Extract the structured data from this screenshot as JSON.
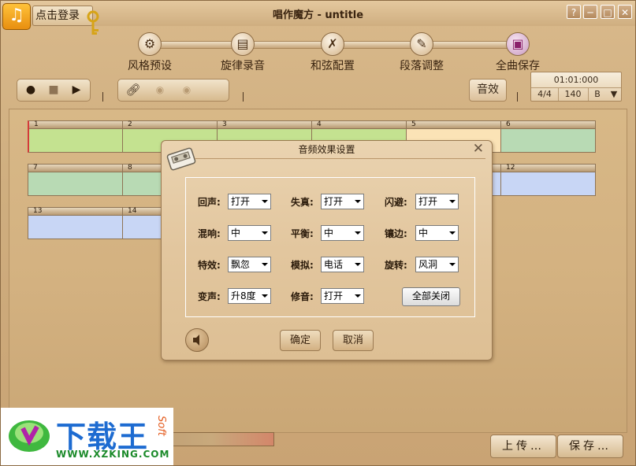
{
  "window": {
    "title": "唱作魔方 - untitle",
    "login_label": "点击登录",
    "buttons": [
      "?",
      "─",
      "□",
      "✕"
    ]
  },
  "steps": [
    {
      "label": "风格预设",
      "icon": "gear-icon",
      "active": false
    },
    {
      "label": "旋律录音",
      "icon": "folder-chart-icon",
      "active": false
    },
    {
      "label": "和弦配置",
      "icon": "tools-icon",
      "active": false
    },
    {
      "label": "段落调整",
      "icon": "edit-icon",
      "active": false
    },
    {
      "label": "全曲保存",
      "icon": "save-disk-icon",
      "active": true
    }
  ],
  "transport": {
    "icons": [
      "record-icon",
      "stop-icon",
      "play-icon"
    ]
  },
  "toolbar": {
    "effect_label": "音效",
    "time": "01:01:000",
    "meter": "4/4",
    "tempo": "140",
    "key": "B",
    "key_arrow": "▼"
  },
  "segments": [
    {
      "num": "1",
      "color": "#c4e290",
      "selected": true
    },
    {
      "num": "2",
      "color": "#c4e290"
    },
    {
      "num": "3",
      "color": "#c4e290"
    },
    {
      "num": "4",
      "color": "#c4e290"
    },
    {
      "num": "5",
      "color": "#fbe3b6"
    },
    {
      "num": "6",
      "color": "#b8dab4"
    },
    {
      "num": "7",
      "color": "#b8dab4"
    },
    {
      "num": "8",
      "color": "#b8dab4"
    },
    {
      "num": "11",
      "color": "#c8d6f5"
    },
    {
      "num": "12",
      "color": "#c8d6f5"
    },
    {
      "num": "13",
      "color": "#c8d6f5"
    },
    {
      "num": "14",
      "color": "#c8d6f5"
    }
  ],
  "dialog": {
    "title": "音频效果设置",
    "close": "✕",
    "fields": [
      {
        "label": "回声:",
        "value": "打开"
      },
      {
        "label": "失真:",
        "value": "打开"
      },
      {
        "label": "闪避:",
        "value": "打开"
      },
      {
        "label": "混响:",
        "value": "中"
      },
      {
        "label": "平衡:",
        "value": "中"
      },
      {
        "label": "镶边:",
        "value": "中"
      },
      {
        "label": "特效:",
        "value": "飘忽"
      },
      {
        "label": "模拟:",
        "value": "电话"
      },
      {
        "label": "旋转:",
        "value": "风洞"
      },
      {
        "label": "变声:",
        "value": "升8度"
      },
      {
        "label": "修音:",
        "value": "打开"
      }
    ],
    "close_all_label": "全部关闭",
    "ok_label": "确定",
    "cancel_label": "取消"
  },
  "bottom": {
    "upload_label": "上传…",
    "save_label": "保存…"
  },
  "watermark": {
    "brand": "下载王",
    "url": "WWW.XZKING.COM",
    "soft": "Soft"
  }
}
